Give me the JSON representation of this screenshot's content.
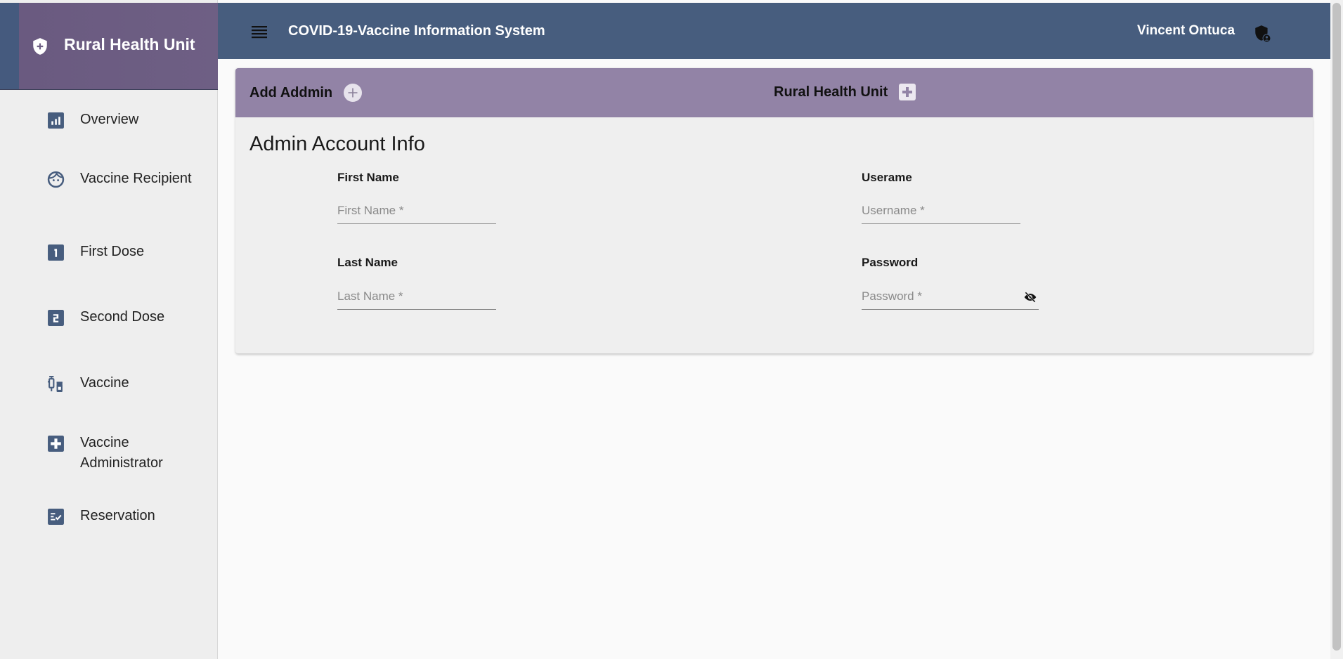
{
  "sidebar": {
    "brand_title": "Rural Health Unit",
    "brand_icon": "shield-plus-icon",
    "items": [
      {
        "label": "Overview",
        "icon": "chart-box-icon"
      },
      {
        "label": "Vaccine Recipient",
        "icon": "face-icon"
      },
      {
        "label": "First Dose",
        "icon": "numeric-1-box-icon"
      },
      {
        "label": "Second Dose",
        "icon": "numeric-2-box-icon"
      },
      {
        "label": "Vaccine",
        "icon": "vaccine-vials-icon"
      },
      {
        "label": "Vaccine Administrator",
        "icon": "medical-plus-box-icon"
      },
      {
        "label": "Reservation",
        "icon": "checklist-box-icon"
      }
    ]
  },
  "topbar": {
    "title": "COVID-19-Vaccine Information System",
    "user_name": "Vincent Ontuca",
    "menu_icon": "menu-icon",
    "user_icon": "shield-account-icon"
  },
  "card": {
    "header_left": "Add Addmin",
    "header_right": "Rural Health Unit",
    "title": "Admin Account Info",
    "fields": {
      "first_name": {
        "label": "First Name",
        "placeholder": "First Name *",
        "value": ""
      },
      "last_name": {
        "label": "Last Name",
        "placeholder": "Last Name *",
        "value": ""
      },
      "username": {
        "label": "Userame",
        "placeholder": "Username *",
        "value": ""
      },
      "password": {
        "label": "Password",
        "placeholder": "Password *",
        "value": ""
      }
    }
  },
  "colors": {
    "topbar": "#475d7e",
    "brand": "#6e5f84",
    "card_header": "#9283a6",
    "icon": "#475d7e"
  }
}
